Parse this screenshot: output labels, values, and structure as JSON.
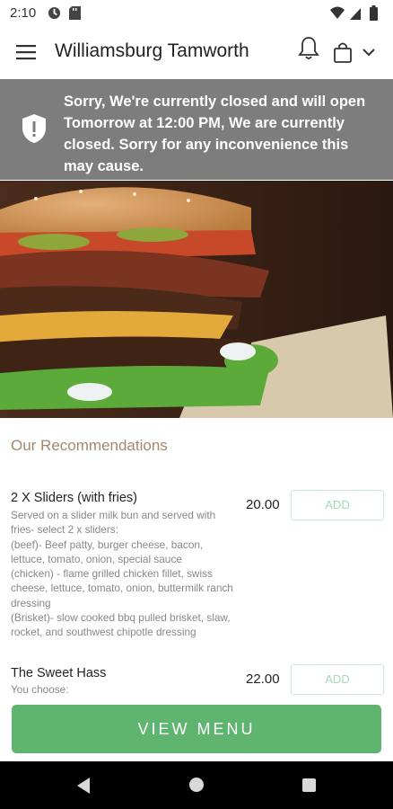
{
  "status_bar": {
    "time": "2:10"
  },
  "header": {
    "store_name": "Williamsburg Tamworth",
    "icons": [
      "menu-icon",
      "bell-icon",
      "shopping-bag-icon",
      "chevron-down-icon"
    ]
  },
  "closed_banner": {
    "message": "Sorry, We're currently closed and will open Tomorrow at 12:00 PM, We are currently closed. Sorry for any inconvenience this may cause.",
    "icon": "shield-alert-icon"
  },
  "recommendations": {
    "title": "Our Recommendations",
    "items": [
      {
        "name": "2 X Sliders (with fries)",
        "description": "Served on a slider milk bun and served with fries- select 2 x sliders:\n (beef)- Beef patty, burger cheese, bacon, lettuce, tomato, onion, special sauce\n (chicken) - flame grilled chicken fillet, swiss cheese, lettuce, tomato, onion, buttermilk ranch dressing\n (Brisket)- slow cooked bbq pulled brisket, slaw, rocket,  and southwest chipotle dressing",
        "price": "20.00",
        "add_label": "ADD"
      },
      {
        "name": "The Sweet Hass",
        "description": "You choose:",
        "price": "22.00",
        "add_label": "ADD"
      }
    ]
  },
  "view_menu_label": "VIEW MENU",
  "colors": {
    "banner": "#7d7d7d",
    "accent_green": "#5fb46f",
    "recommendation_title": "#a2896a"
  }
}
